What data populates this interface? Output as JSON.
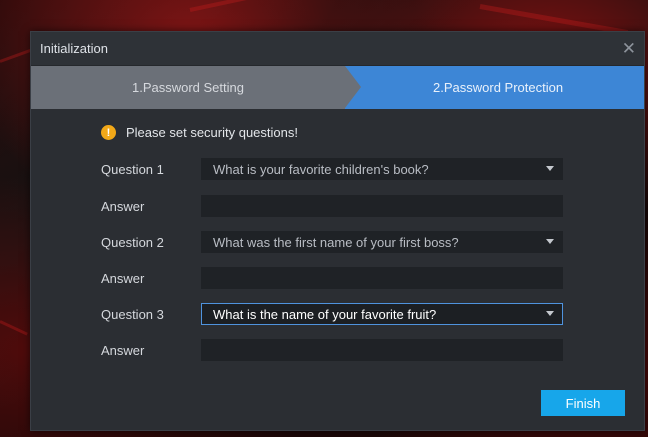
{
  "window": {
    "title": "Initialization",
    "close_glyph": "✕"
  },
  "steps": [
    {
      "label": "1.Password Setting",
      "state": "done"
    },
    {
      "label": "2.Password Protection",
      "state": "active"
    }
  ],
  "notice": {
    "icon": "warning-icon",
    "icon_glyph": "!",
    "text": "Please set security questions!"
  },
  "questions": [
    {
      "label": "Question 1",
      "value": "What is your favorite children's book?",
      "answer_label": "Answer",
      "answer": ""
    },
    {
      "label": "Question 2",
      "value": "What was the first name of your first boss?",
      "answer_label": "Answer",
      "answer": ""
    },
    {
      "label": "Question 3",
      "value": "What is the name of your favorite fruit?",
      "answer_label": "Answer",
      "answer": ""
    }
  ],
  "footer": {
    "finish_label": "Finish"
  },
  "colors": {
    "accent": "#3d86d6",
    "button": "#17a6ea",
    "warning": "#f2a818",
    "dialog_bg": "#2b2e33"
  }
}
